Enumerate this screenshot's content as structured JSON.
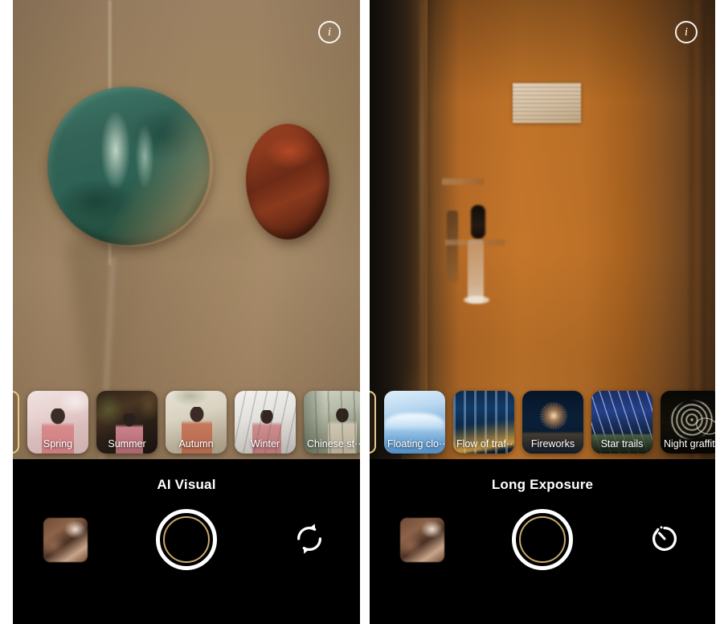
{
  "app": {
    "screens": [
      {
        "id": "ai-visual",
        "mode_title": "AI Visual",
        "info_icon": "info-icon",
        "info_glyph": "i",
        "scene_description": "Beige wall corner with a green ceramic plate and a rust-red ceramic plate",
        "filters": [
          {
            "label": "Spring",
            "thumb": "spring-portrait-thumb",
            "selected": false
          },
          {
            "label": "Summer",
            "thumb": "summer-portrait-thumb",
            "selected": false
          },
          {
            "label": "Autumn",
            "thumb": "autumn-portrait-thumb",
            "selected": false
          },
          {
            "label": "Winter",
            "thumb": "winter-portrait-thumb",
            "selected": false
          },
          {
            "label": "Chinese st··",
            "thumb": "chinese-style-portrait-thumb",
            "selected": false
          }
        ],
        "gallery_thumb": "last-photo-thumbnail",
        "shutter": "shutter-button",
        "right_action": {
          "icon": "camera-flip-icon",
          "label": "Switch camera"
        }
      },
      {
        "id": "long-exposure",
        "mode_title": "Long Exposure",
        "info_icon": "info-icon",
        "info_glyph": "i",
        "scene_description": "Dim amber-lit corridor with a closed door and a notice sheet",
        "filters": [
          {
            "label": "Floating clo··",
            "thumb": "floating-clouds-thumb",
            "selected": false
          },
          {
            "label": "Flow of traf··",
            "thumb": "flow-of-traffic-thumb",
            "selected": false
          },
          {
            "label": "Fireworks",
            "thumb": "fireworks-thumb",
            "selected": false
          },
          {
            "label": "Star trails",
            "thumb": "star-trails-thumb",
            "selected": false
          },
          {
            "label": "Night graffiti",
            "thumb": "night-graffiti-thumb",
            "selected": false
          }
        ],
        "gallery_thumb": "last-photo-thumbnail",
        "shutter": "shutter-button",
        "right_action": {
          "icon": "timer-icon",
          "label": "Timer"
        }
      }
    ],
    "colors": {
      "accent_gold": "#c8a869",
      "selection_border": "#e8c98a",
      "control_bar": "#000000",
      "text_primary": "#ffffff",
      "page_background": "#ffffff"
    }
  }
}
